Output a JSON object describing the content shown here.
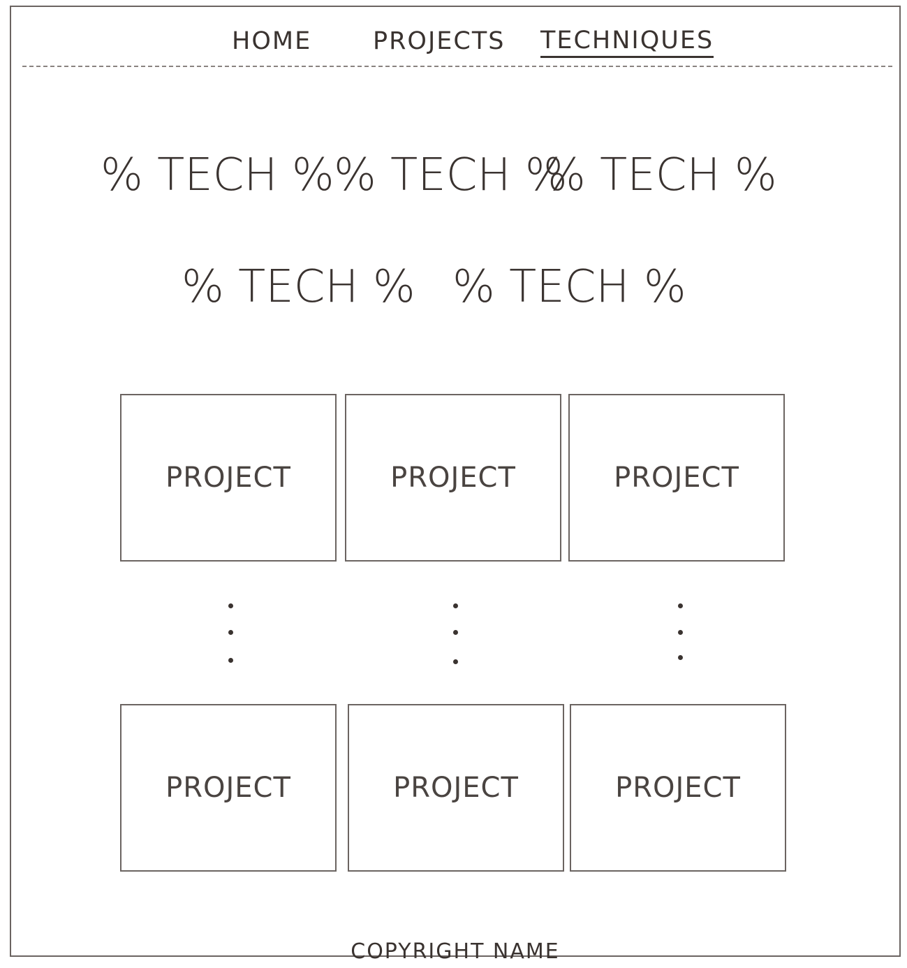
{
  "nav": {
    "items": [
      {
        "label": "HOME",
        "active": false
      },
      {
        "label": "PROJECTS",
        "active": false
      },
      {
        "label": "TECHNIQUES",
        "active": true
      }
    ]
  },
  "techniques": {
    "row1": [
      "% TECH %",
      "% TECH %",
      "% TECH %"
    ],
    "row2": [
      "% TECH %",
      "% TECH %"
    ]
  },
  "projects": {
    "top": [
      "PROJECT",
      "PROJECT",
      "PROJECT"
    ],
    "bottom": [
      "PROJECT",
      "PROJECT",
      "PROJECT"
    ]
  },
  "footer": {
    "text": "COPYRIGHT NAME"
  },
  "colors": {
    "ink": "#3a3330",
    "border": "#6b6461",
    "background": "#ffffff"
  }
}
